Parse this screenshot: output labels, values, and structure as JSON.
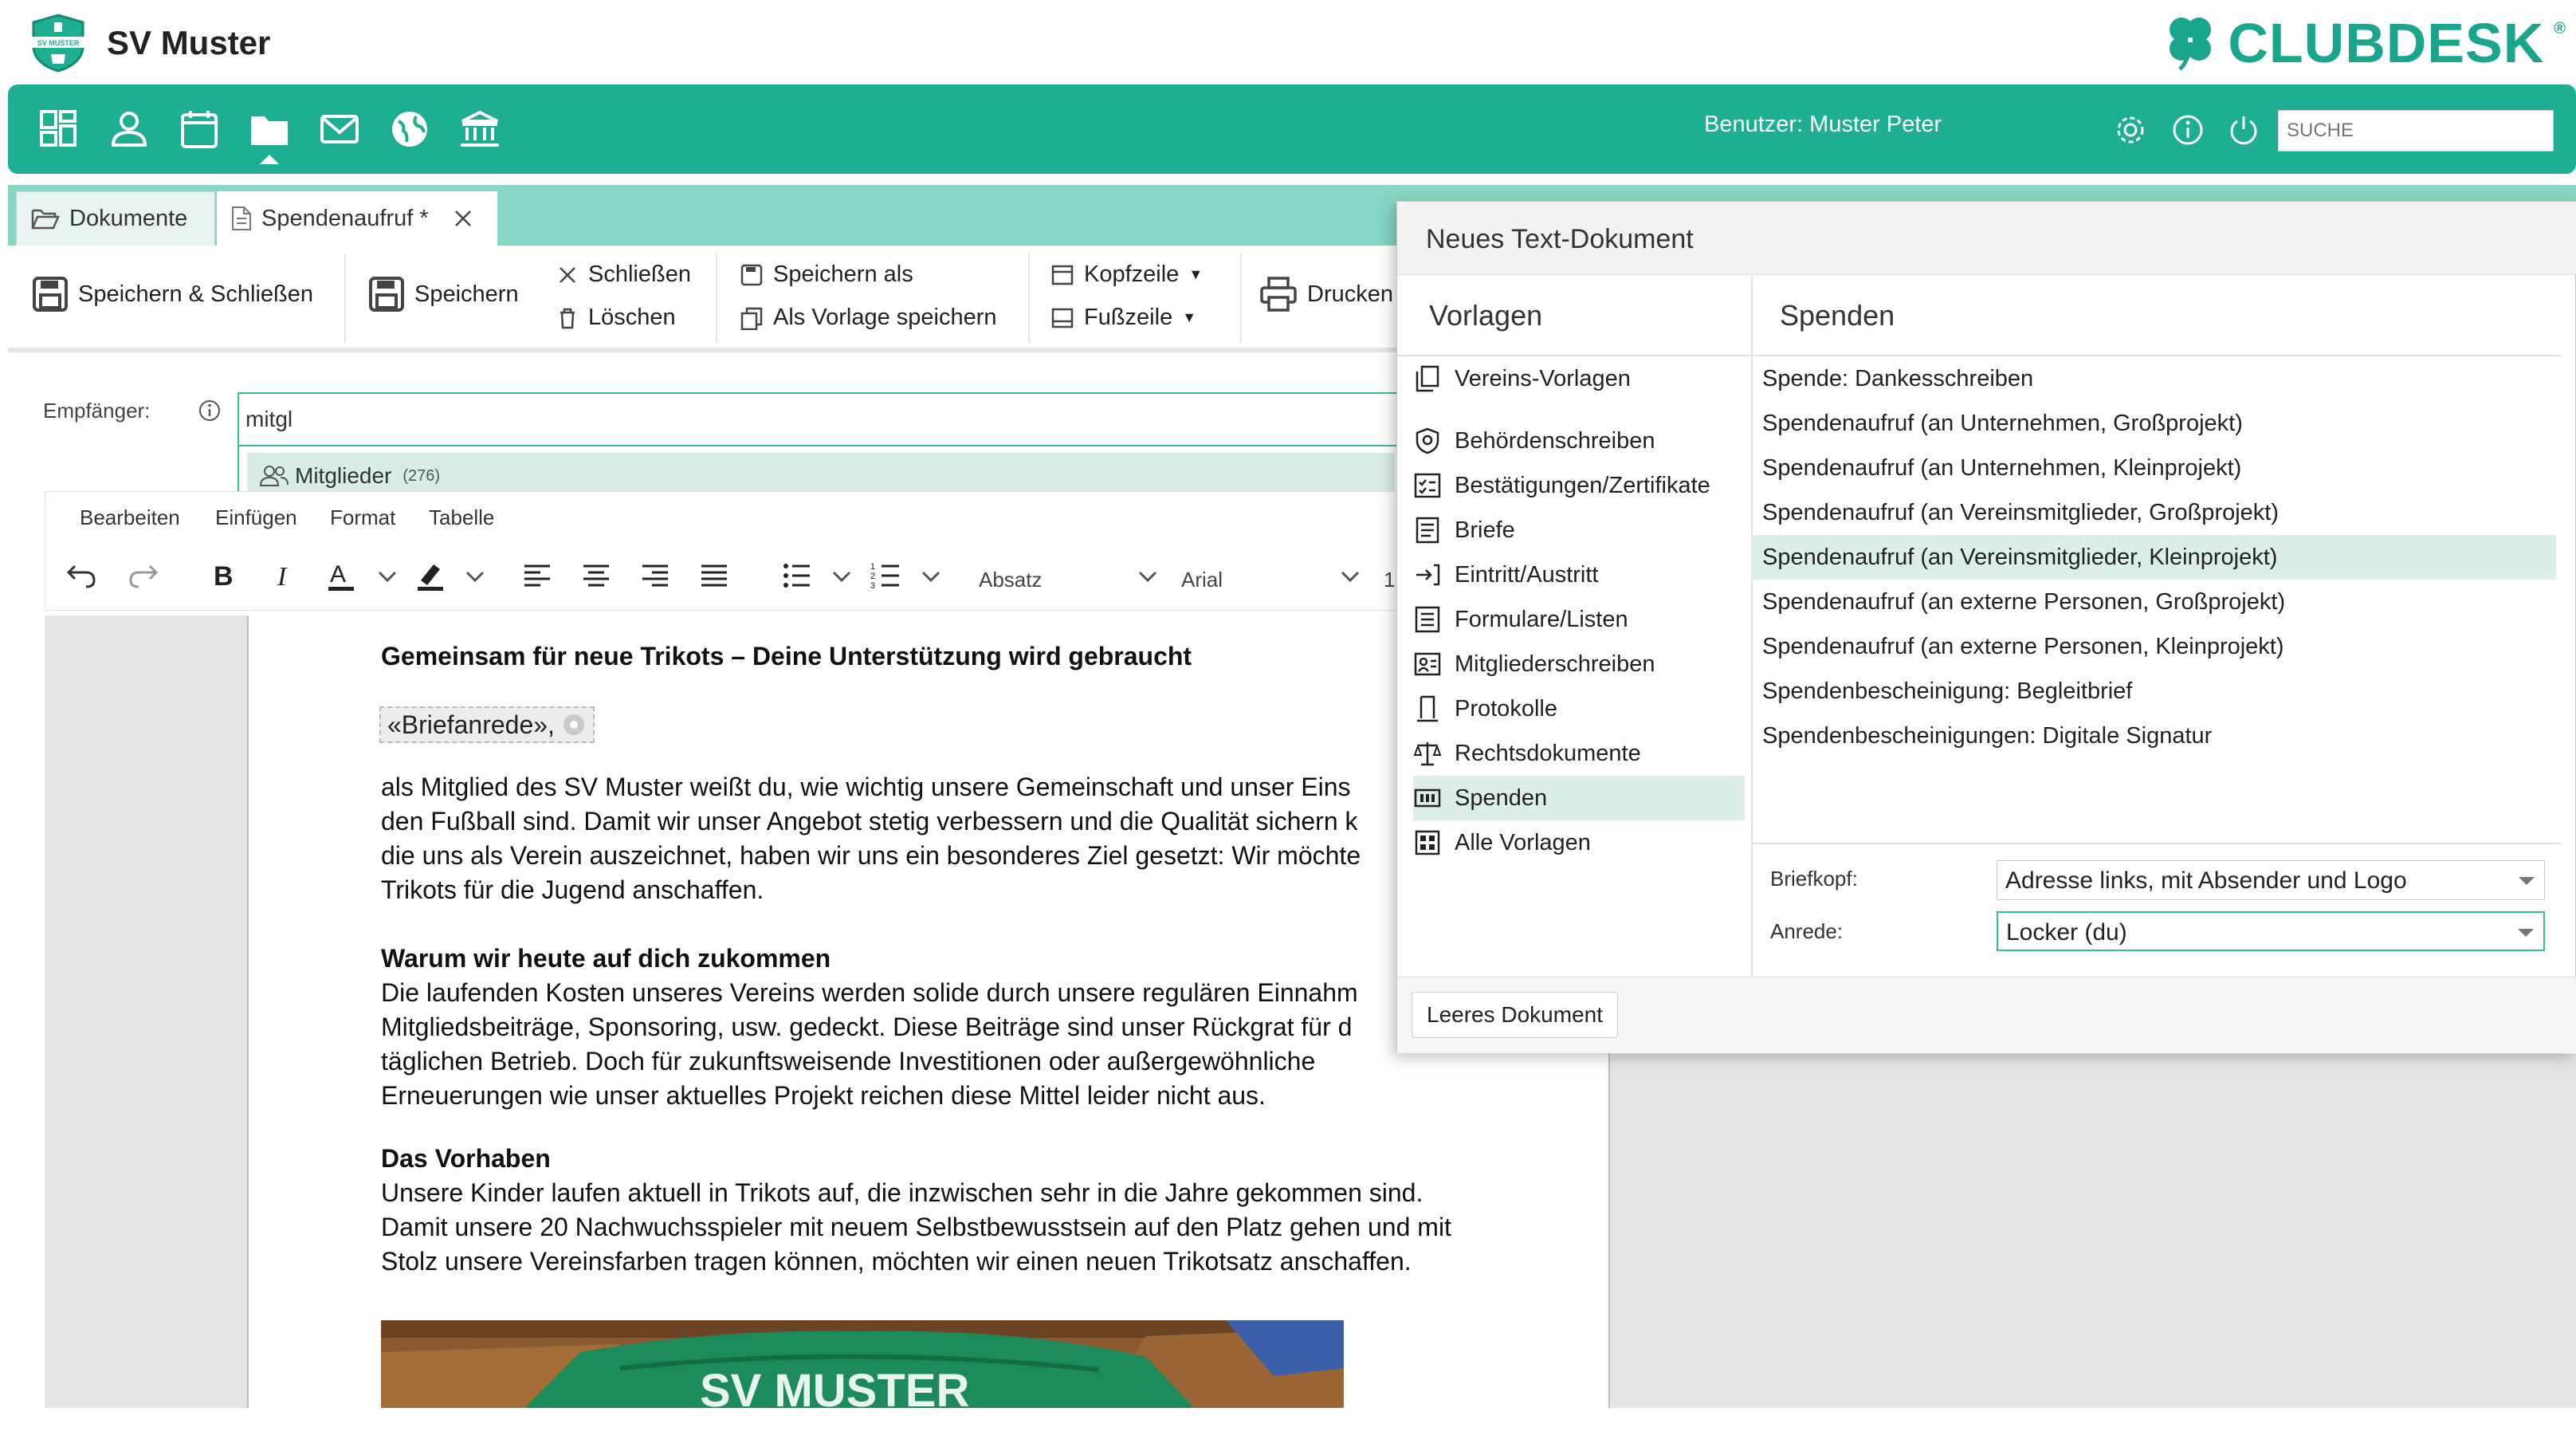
{
  "app": {
    "club_name": "SV Muster",
    "brand": "CLUBDESK",
    "brand_mark": "®",
    "logo_text": "SV MUSTER",
    "user_label": "Benutzer: Muster Peter",
    "search_placeholder": "SUCHE",
    "accent_color": "#1eae92"
  },
  "nav": {
    "icons": [
      "dashboard-icon",
      "person-icon",
      "calendar-icon",
      "folder-icon",
      "mail-icon",
      "globe-icon",
      "bank-icon"
    ],
    "active": "folder-icon",
    "right_icons": [
      "gear-icon",
      "info-icon",
      "power-icon"
    ]
  },
  "tabs": [
    {
      "label": "Dokumente",
      "icon": "folder-open-icon"
    },
    {
      "label": "Spendenaufruf *",
      "icon": "document-icon",
      "closable": true
    }
  ],
  "toolbar": {
    "save_close": "Speichern & Schließen",
    "save": "Speichern",
    "close": "Schließen",
    "delete": "Löschen",
    "save_as": "Speichern als",
    "save_template": "Als Vorlage speichern",
    "header": "Kopfzeile",
    "footer": "Fußzeile",
    "print": "Drucken"
  },
  "recipient": {
    "label": "Empfänger:",
    "value": "mitgl",
    "suggestion_label": "Mitglieder",
    "suggestion_count": "(276)"
  },
  "editor": {
    "menu": [
      "Bearbeiten",
      "Einfügen",
      "Format",
      "Tabelle"
    ],
    "block_format": "Absatz",
    "font": "Arial",
    "font_size_partial": "1"
  },
  "document": {
    "heading": "Gemeinsam für neue Trikots – Deine Unterstützung wird gebraucht",
    "salutation_field": "«Briefanrede»,",
    "p1": [
      "als Mitglied des SV Muster weißt du, wie wichtig unsere Gemeinschaft und unser Eins",
      "den Fußball sind. Damit wir unser Angebot stetig verbessern und die Qualität sichern k",
      "die uns als Verein auszeichnet, haben wir uns ein besonderes Ziel gesetzt: Wir möchte",
      "Trikots für die Jugend anschaffen."
    ],
    "h2": "Warum wir heute auf dich zukommen",
    "p2": [
      "Die laufenden Kosten unseres Vereins werden solide durch unsere regulären Einnahm",
      "Mitgliedsbeiträge, Sponsoring, usw. gedeckt. Diese Beiträge sind unser Rückgrat für d",
      "täglichen Betrieb. Doch für zukunftsweisende Investitionen oder außergewöhnliche",
      "Erneuerungen wie unser aktuelles Projekt reichen diese Mittel leider nicht aus."
    ],
    "h3": "Das Vorhaben",
    "p3": [
      "Unsere Kinder laufen aktuell in Trikots auf, die inzwischen sehr in die Jahre gekommen sind.",
      "Damit unsere 20 Nachwuchsspieler mit neuem Selbstbewusstsein auf den Platz gehen und mit",
      "Stolz unsere Vereinsfarben tragen können, möchten wir einen neuen Trikotsatz  anschaffen."
    ],
    "image_caption_text": "SV MUSTER"
  },
  "dialog": {
    "title": "Neues Text-Dokument",
    "col_left": "Vorlagen",
    "col_right": "Spenden",
    "categories": [
      {
        "label": "Vereins-Vorlagen",
        "icon": "copy-icon"
      },
      {
        "label": "Behördenschreiben",
        "icon": "shield-icon"
      },
      {
        "label": "Bestätigungen/Zertifikate",
        "icon": "checklist-icon"
      },
      {
        "label": "Briefe",
        "icon": "letter-icon"
      },
      {
        "label": "Eintritt/Austritt",
        "icon": "enter-exit-icon"
      },
      {
        "label": "Formulare/Listen",
        "icon": "list-icon"
      },
      {
        "label": "Mitgliederschreiben",
        "icon": "members-icon"
      },
      {
        "label": "Protokolle",
        "icon": "protocol-icon"
      },
      {
        "label": "Rechtsdokumente",
        "icon": "scales-icon"
      },
      {
        "label": "Spenden",
        "icon": "donation-icon"
      },
      {
        "label": "Alle Vorlagen",
        "icon": "grid-icon"
      }
    ],
    "selected_category": "Spenden",
    "templates": [
      "Spende: Dankesschreiben",
      "Spendenaufruf (an Unternehmen, Großprojekt)",
      "Spendenaufruf (an Unternehmen, Kleinprojekt)",
      "Spendenaufruf (an Vereinsmitglieder, Großprojekt)",
      "Spendenaufruf (an Vereinsmitglieder, Kleinprojekt)",
      "Spendenaufruf (an externe Personen, Großprojekt)",
      "Spendenaufruf (an externe Personen, Kleinprojekt)",
      "Spendenbescheinigung: Begleitbrief",
      "Spendenbescheinigungen: Digitale Signatur"
    ],
    "selected_template": "Spendenaufruf (an Vereinsmitglieder, Kleinprojekt)",
    "letterhead_label": "Briefkopf:",
    "letterhead_value": "Adresse links, mit Absender und Logo",
    "salutation_label": "Anrede:",
    "salutation_value": "Locker (du)",
    "empty_doc_button": "Leeres Dokument"
  }
}
